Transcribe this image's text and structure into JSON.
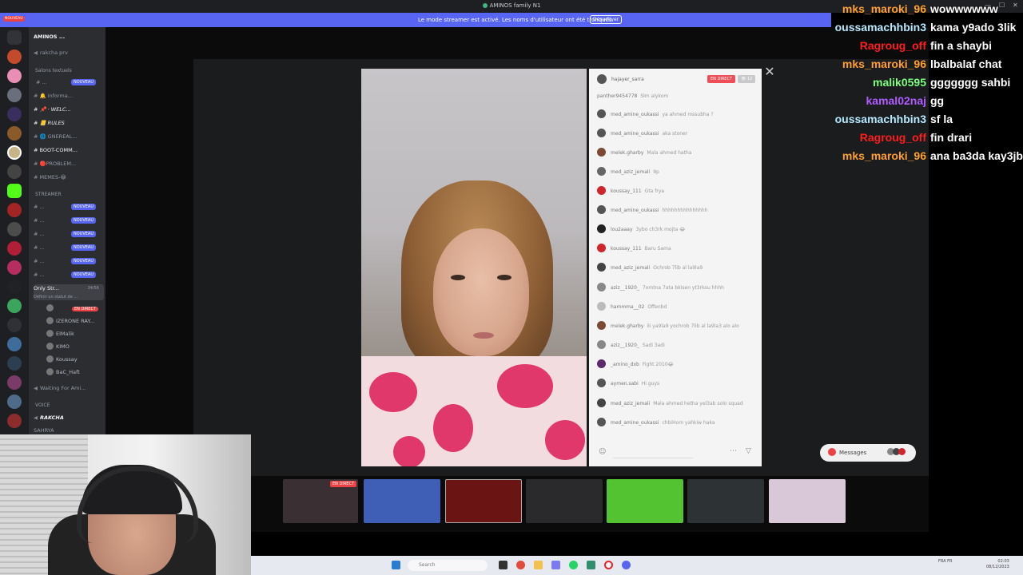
{
  "window": {
    "title": "AMINOS family N1",
    "controls": [
      "—",
      "☐",
      "✕"
    ]
  },
  "streamer_banner": {
    "text": "Le mode streamer est activé. Les noms d'utilisateur ont été tronqués.",
    "button": "Désactiver"
  },
  "server_rail": {
    "new_label": "NOUVEAU"
  },
  "sidebar": {
    "server_name": "AMINOS ...",
    "top_channel": "rakcha prv",
    "category_text": "Salons textuels",
    "text_channels": [
      {
        "label": "# ...",
        "badge": "NOUVEAU"
      },
      {
        "label": "# 🔔 informa..."
      },
      {
        "label": "# 📌 · WELC..."
      },
      {
        "label": "# 📒 RULES"
      },
      {
        "label": "# 🌐 GNEREAL..."
      },
      {
        "label": "# BOOT-COMM..."
      },
      {
        "label": "# 🔴PROBLEM..."
      },
      {
        "label": "# MEMES-😂"
      }
    ],
    "category_streamer": "STREAMER",
    "streamer_channels": [
      {
        "label": "# ...",
        "badge": "NOUVEAU"
      },
      {
        "label": "# ...",
        "badge": "NOUVEAU"
      },
      {
        "label": "# ...",
        "badge": "NOUVEAU"
      },
      {
        "label": "# ...",
        "badge": "NOUVEAU"
      },
      {
        "label": "# ...",
        "badge": "NOUVEAU"
      },
      {
        "label": "# ...",
        "badge": "NOUVEAU"
      }
    ],
    "voice_channel": {
      "label": "Only Str...",
      "count": "34/56",
      "sub": "Définir un statut de ..."
    },
    "voice_users": [
      {
        "name": "",
        "badge": "EN DIRECT"
      },
      {
        "name": "IZERONE RAY..."
      },
      {
        "name": "ElMalik"
      },
      {
        "name": "KIMO"
      },
      {
        "name": "Koussay"
      },
      {
        "name": "BaC_Haft"
      }
    ],
    "waiting_channel": "Waiting For Ami...",
    "voice_category": "VOICE",
    "voice_rakcha": "RAKCHA",
    "voice_sahrya": "SAHRYA"
  },
  "live_chat": {
    "host": "hajayer_sarra",
    "live_badge": "EN DIRECT",
    "viewers": "12",
    "messages": [
      {
        "user": "panther9454778",
        "text": "Slm alykom"
      },
      {
        "user": "med_amine_oukassi",
        "text": "ya ahmed mssubha ?"
      },
      {
        "user": "med_amine_oukassi",
        "text": "aka stoner"
      },
      {
        "user": "melek.gharby",
        "text": "Mala ahmed hatha"
      },
      {
        "user": "med_aziz_jemali",
        "text": "9p"
      },
      {
        "user": "koussay_111",
        "text": "Gta frya"
      },
      {
        "user": "med_amine_oukassi",
        "text": "hhhhhhhhhhhhhhh"
      },
      {
        "user": "lou2aaay",
        "text": "3ybo ch3rk mojta 😂"
      },
      {
        "user": "koussay_111",
        "text": "Baru Sama"
      },
      {
        "user": "med_aziz_jemali",
        "text": "Ochrob 7lib al la9la9"
      },
      {
        "user": "aziz__1920_",
        "text": "7omtna 7ata bkisen yt3rkou hhhh"
      },
      {
        "user": "hammma__02",
        "text": "Offenbd"
      },
      {
        "user": "melek.gharby",
        "text": "ili ya9la9 yochrob 7lib al la9la3 alo alo"
      },
      {
        "user": "aziz__1920_",
        "text": "Sadi 3adi"
      },
      {
        "user": "_amino_dxb",
        "text": "Fight 2010😂"
      },
      {
        "user": "aymen.sabi",
        "text": "Hi guys"
      },
      {
        "user": "med_aziz_jemali",
        "text": "Mala ahmed hetha yel3ab solo squad"
      },
      {
        "user": "med_amine_oukassi",
        "text": "chbiHom yahkiw haka"
      }
    ]
  },
  "messages_button": {
    "label": "Messages"
  },
  "thumbnails": [
    {
      "name": "thumb-hajayer",
      "tag": "EN DIRECT",
      "color": "#3a3033"
    },
    {
      "name": "thumb-blue",
      "color": "#3f5fb6"
    },
    {
      "name": "thumb-red",
      "color": "#6b1414"
    },
    {
      "name": "thumb-dark",
      "color": "#2a2a2d"
    },
    {
      "name": "thumb-kick",
      "color": "#53c331"
    },
    {
      "name": "thumb-cartoon",
      "color": "#2d3234"
    },
    {
      "name": "thumb-anime",
      "color": "#d9c8d8"
    }
  ],
  "taskbar": {
    "search_placeholder": "Search",
    "tray_lang": "FRA\nFR",
    "tray_time": "02:03",
    "tray_date": "08/12/2023"
  },
  "twitch_overlay": [
    {
      "user": "mks_maroki_96",
      "text": "wowwwwww",
      "color": "#ff9f2e"
    },
    {
      "user": "oussamachhbin3",
      "text": "kama y9ado 3lik",
      "color": "#b7e9ff"
    },
    {
      "user": "Ragroug_off",
      "text": "fin a shaybi",
      "color": "#ff1e1e"
    },
    {
      "user": "mks_maroki_96",
      "text": "lbalbalaf chat",
      "color": "#ff9f2e"
    },
    {
      "user": "malik0595",
      "text": "ggggggg sahbi",
      "color": "#7cff7c"
    },
    {
      "user": "kamal02naj",
      "text": "gg",
      "color": "#b05cff"
    },
    {
      "user": "oussamachhbin3",
      "text": "sf la",
      "color": "#b7e9ff"
    },
    {
      "user": "Ragroug_off",
      "text": "fin drari",
      "color": "#ff1e1e"
    },
    {
      "user": "mks_maroki_96",
      "text": "ana ba3da kay3jb",
      "color": "#ff9f2e"
    }
  ]
}
